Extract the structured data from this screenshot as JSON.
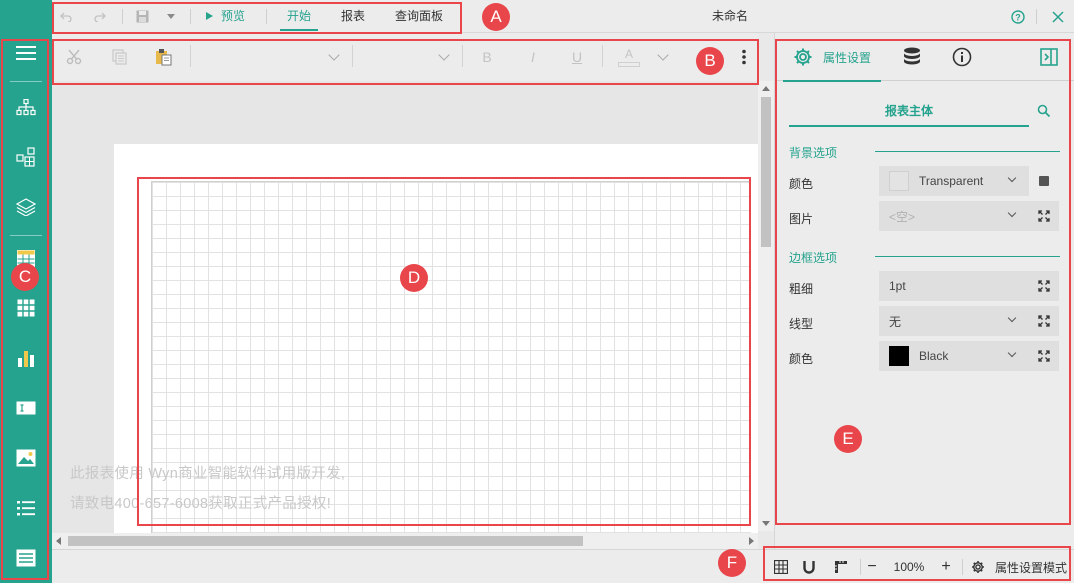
{
  "app": {
    "document_title": "未命名",
    "colors": {
      "accent": "#26a38e",
      "annotation": "#e8464a"
    }
  },
  "topbar": {
    "undo_icon": "undo-icon",
    "redo_icon": "redo-icon",
    "save_icon": "save-icon",
    "preview_label": "预览",
    "menu": [
      "开始",
      "报表",
      "查询面板"
    ],
    "active_menu": "开始",
    "help_icon": "help-circle-icon",
    "close_icon": "close-icon"
  },
  "toolbar": {
    "tools": [
      "cut-icon",
      "copy-icon",
      "paste-icon",
      "font-family-dropdown",
      "font-size-dropdown",
      "bold-icon",
      "italic-icon",
      "underline-icon",
      "font-color-icon",
      "more-icon"
    ],
    "bold_label": "B",
    "italic_label": "I",
    "underline_label": "U",
    "font_color_label": "A"
  },
  "sidebar": {
    "items": [
      "menu-icon",
      "hierarchy-icon",
      "components-icon",
      "layers-icon",
      "table-icon",
      "matrix-icon",
      "chart-icon",
      "textbox-icon",
      "image-icon",
      "list-icon",
      "form-icon"
    ]
  },
  "canvas": {
    "watermark_line1": "此报表使用 Wyn商业智能软件试用版开发,",
    "watermark_line2": "请致电400-657-6008获取正式产品授权!"
  },
  "panel": {
    "tabs": [
      {
        "icon": "gear-icon",
        "label": "属性设置"
      },
      {
        "icon": "database-icon",
        "label": ""
      },
      {
        "icon": "info-icon",
        "label": ""
      }
    ],
    "dock_icon": "panel-dock-icon",
    "section_tab": "报表主体",
    "search_icon": "search-icon",
    "background_section": {
      "title": "背景选项",
      "color_label": "颜色",
      "color_value": "Transparent",
      "image_label": "图片",
      "image_value": "<空>"
    },
    "border_section": {
      "title": "边框选项",
      "width_label": "粗细",
      "width_value": "1pt",
      "style_label": "线型",
      "style_value": "无",
      "color_label": "颜色",
      "color_value": "Black",
      "color_swatch": "#000000"
    }
  },
  "statusbar": {
    "zoom": "100%",
    "mode_label": "属性设置模式",
    "grid_icon": "grid-icon",
    "snap_icon": "magnet-icon",
    "ruler_icon": "ruler-icon",
    "zoom_out_label": "−",
    "zoom_in_label": "+"
  },
  "annotations": [
    "A",
    "B",
    "C",
    "D",
    "E",
    "F"
  ]
}
